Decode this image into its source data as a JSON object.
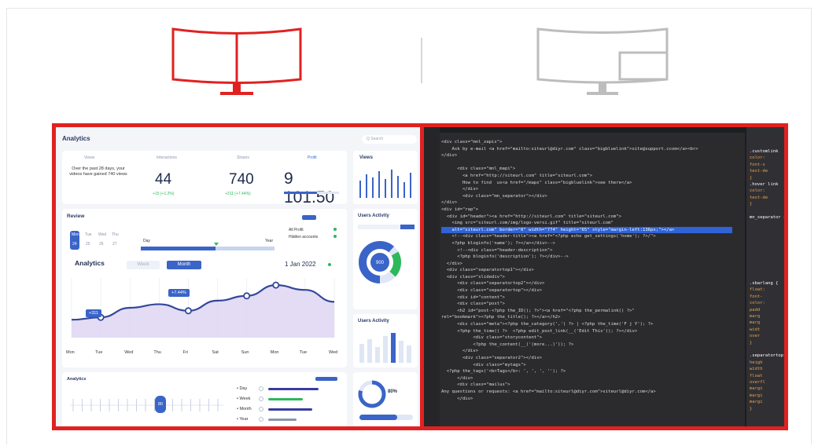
{
  "colors": {
    "accent": "#e12121",
    "inactive": "#bdbdbd",
    "dash_blue": "#3a64c8",
    "code_bg": "#2b2b2e",
    "highlight": "#2f63d6"
  },
  "icons": {
    "left_monitor": "dual-monitor-icon",
    "right_monitor": "pip-monitor-icon"
  },
  "dashboard": {
    "title": "Analytics",
    "search_placeholder": "Q Search",
    "stats": [
      {
        "label": "Views",
        "value": "",
        "sub": ""
      },
      {
        "label": "Interactions",
        "value": "44",
        "sub": "+15 (+1.2%)"
      },
      {
        "label": "Shares",
        "value": "740",
        "sub": "+311 (+7.44%)"
      },
      {
        "label": "Profit",
        "value": "9 101.50",
        "sub": ""
      }
    ],
    "intro_text": "Over the past 28 days, your videos have gained 740 views",
    "views_card_title": "Views",
    "review_title": "Review",
    "review_legend": [
      "All Profit",
      "Hidden accounts"
    ],
    "day_labels": [
      "Mon",
      "Tue",
      "Wed",
      "Thu"
    ],
    "day_nums": [
      "24",
      "25",
      "26",
      "27"
    ],
    "range_labels": [
      "Day",
      "Year"
    ],
    "chart_title": "Analytics",
    "week_label": "Week",
    "month_label": "Month",
    "date_label": "1 Jan 2022",
    "badge_311": "+311",
    "badge_744": "+7.44%",
    "x_days": [
      "Mon",
      "Tue",
      "Wed",
      "Thu",
      "Fri",
      "Sat",
      "Sun",
      "Mon",
      "Tue",
      "Wed"
    ],
    "users_activity_title": "Users Activity",
    "donut_value": "900",
    "users_activity_title2": "Users Activity",
    "bottom_title": "Analytics",
    "bottom_value": "80",
    "bottom_pct": "80%",
    "legend_rows": [
      "Day",
      "Week",
      "Month",
      "Year"
    ]
  },
  "chart_data": {
    "type": "area",
    "categories": [
      "Mon",
      "Tue",
      "Wed",
      "Thu",
      "Fri",
      "Sat",
      "Sun",
      "Mon",
      "Tue",
      "Wed"
    ],
    "series": [
      {
        "values": [
          30,
          34,
          50,
          56,
          45,
          62,
          70,
          88,
          80,
          60
        ]
      }
    ],
    "annotations": [
      "+311",
      "+7.44%"
    ]
  },
  "code": {
    "lines": [
      "<div class=\"mnl_zapis\">",
      "    Ask by e-mail <a href=\"mailto:siteurl@diyr.com\" class=\"bigbluelink\">site@support.ccom</a><br>",
      "</div>",
      "",
      "      <div class=\"mnl_mapi\">",
      "        <a href=\"http://siteurl.com\" title=\"siteurl.com\">",
      "        How to find  us<a href=\"/maps\" class=\"bigbluelink\">see there</a>",
      "        </div>",
      "        <div class=\"mn_separator\"></div>",
      "</div>",
      "<div id=\"rap\">",
      "  <div id=\"header\"><a href=\"http://siteurl.com\" title=\"siteurl.com\">",
      "    <img src=\"siteurl.com/img/logo-versi.gif\" title=\"siteurl.com\"",
      "    alt=\"siteurl.com\" border=\"0\" width=\"774\" height=\"65\" style=\"margin-left:136px;\"></a>",
      "    <!--<div class=\"header-title\"><a href=\"<?php echo get_settings('home'); ?>/\">",
      "    <?php bloginfo('name'); ?></a></div>-->",
      "      <!--<div class=\"header-description\">",
      "      <?php bloginfo('description'); ?></div>-->",
      "  </div>",
      "  <div class=\"separatortop1\"></div>",
      "  <div class=\"slidediv\">",
      "      <div class=\"separatortop2\"></div>",
      "      <div class=\"separatortop\"></div>",
      "      <div id=\"content\">",
      "      <div class=\"post\">",
      "      <h2 id=\"post-<?php the_ID(); ?>\"><a href=\"<?php the_permalink() ?>\"",
      "rel=\"bookmark\"><?php the_title(); ?></a></h2>",
      "      <div class=\"meta\"><?php the_category(',') ?> | <?php the_time('F j Y'); ?>",
      "      <?php the_time() ?>  <?php edit_post_link(__('Edit This')); ?></div>",
      "            <div class=\"storycontent\">",
      "            <?php the_content(__('(more...)')); ?>",
      "        </div>",
      "        <div class=\"separator2\"></div>",
      "            <div class=\"mytags\">",
      "  <?php the_tags('<b>Tags</b>: ', ', ', ''); ?>",
      "      </div>",
      "      <div class=\"mailus\">",
      "Any questions or requests: <a href=\"mailto:siteurl@diyr.com\">siteurl@diyr.com</a>",
      "      </div>"
    ],
    "highlight_index": 13,
    "side_lines": [
      ".customlink",
      "  color:",
      "  font-s",
      "  text-de",
      "  }",
      ".hover link",
      "  color:",
      "  text-de",
      "  }",
      "",
      "mn_separator {",
      "",
      "",
      "",
      "",
      "",
      "",
      "",
      "",
      "",
      ".sbarlang {",
      "  float:",
      "  font-",
      "  color:",
      "  padd",
      "  marg",
      "  marg",
      "  widt",
      "  over",
      "  }",
      "",
      ".separatortop",
      "  heigh",
      "  width",
      "  float",
      "  overfl",
      "  margi",
      "  margi",
      "  margi",
      "  }"
    ]
  }
}
